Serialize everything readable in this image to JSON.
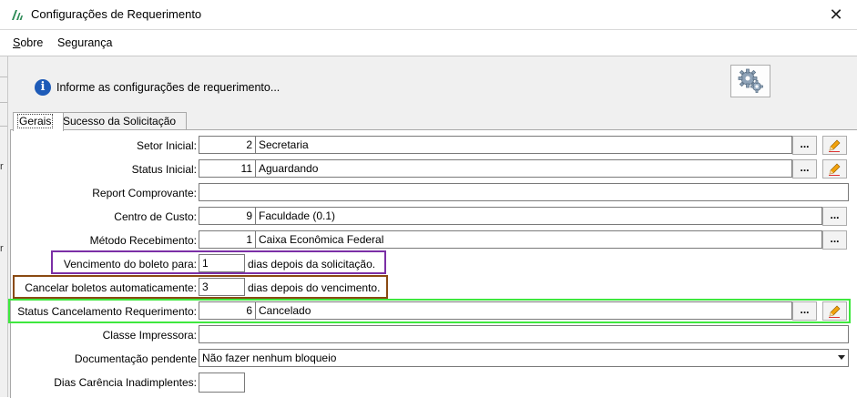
{
  "window": {
    "title": "Configurações de Requerimento",
    "close_glyph": "✕"
  },
  "menu": {
    "items": [
      {
        "label": "Sobre",
        "accel": "S",
        "rest": "obre"
      },
      {
        "label": "Segurança"
      }
    ]
  },
  "left_edge": {
    "letters": [
      "r",
      "r"
    ]
  },
  "info": {
    "icon_glyph": "i",
    "text": "Informe as configurações de requerimento..."
  },
  "tabs": [
    {
      "label": "Gerais",
      "active": true
    },
    {
      "label": "Sucesso da Solicitação",
      "active": false
    }
  ],
  "form": {
    "setor_inicial": {
      "label": "Setor Inicial:",
      "code": "2",
      "description": "Secretaria",
      "lookup": "..."
    },
    "status_inicial": {
      "label": "Status Inicial:",
      "code": "11",
      "description": "Aguardando",
      "lookup": "..."
    },
    "report_comprovante": {
      "label": "Report Comprovante:",
      "value": ""
    },
    "centro_custo": {
      "label": "Centro de Custo:",
      "code": "9",
      "description": "Faculdade (0.1)",
      "lookup": "..."
    },
    "metodo_recebimento": {
      "label": "Método Recebimento:",
      "code": "1",
      "description": "Caixa Econômica Federal",
      "lookup": "..."
    },
    "vencimento_boleto": {
      "label": "Vencimento do boleto para:",
      "value": "1",
      "suffix": "dias depois da solicitação."
    },
    "cancelar_boletos": {
      "label": "Cancelar boletos automaticamente:",
      "value": "3",
      "suffix": "dias depois do vencimento."
    },
    "status_cancelamento": {
      "label": "Status Cancelamento Requerimento:",
      "code": "6",
      "description": "Cancelado",
      "lookup": "..."
    },
    "classe_impressora": {
      "label": "Classe Impressora:",
      "value": ""
    },
    "documentacao_pendente": {
      "label": "Documentação pendente",
      "selected": "Não fazer nenhum bloqueio"
    },
    "dias_carencia": {
      "label": "Dias Carência Inadimplentes:",
      "value": ""
    }
  },
  "highlight_colors": {
    "purple": "#7b2fa6",
    "brown": "#8a4a12",
    "green": "#3ee83e"
  }
}
